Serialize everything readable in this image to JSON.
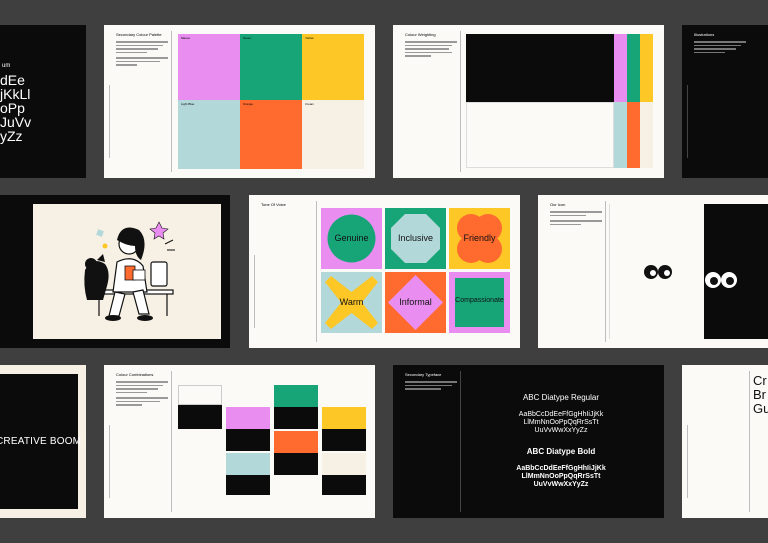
{
  "colors": {
    "bg": "#3f3f3f",
    "magenta": "#e98ef0",
    "green": "#17a578",
    "yellow": "#fdc726",
    "blue": "#b3d8da",
    "orange": "#ff6a2e",
    "cream": "#f7f1e5",
    "black": "#0b0b0b"
  },
  "row1": {
    "type_specimen": {
      "header": "um",
      "lines": [
        "dEe",
        "jKkLl",
        "oPp",
        "JuVv",
        "yZz"
      ]
    },
    "secondary_palette": {
      "title": "Secondary Colour Palette",
      "swatch_names": [
        "Mauve",
        "Green",
        "Yellow",
        "Light Blue",
        "Orange",
        "Cream"
      ]
    },
    "colour_weighting": {
      "title": "Colour Weighting"
    },
    "illustrations": {
      "title": "Illustrations"
    }
  },
  "row2": {
    "tone_of_voice": {
      "title": "Tone Of Voice",
      "words": [
        "Genuine",
        "Inclusive",
        "Friendly",
        "Warm",
        "Informal",
        "Compassionate"
      ]
    },
    "our_icon": {
      "title": "Our Icon"
    }
  },
  "row3": {
    "creative_boom": "CREATIVE BOOM",
    "colour_combinations": {
      "title": "Colour Combinations"
    },
    "secondary_typeface": {
      "title": "Secondary Typeface",
      "regular_name": "ABC Diatype Regular",
      "regular_lines": [
        "AaBbCcDdEeFfGgHhIiJjKk",
        "LlMmNnOoPpQqRrSsTt",
        "UuVvWwXxYyZz"
      ],
      "bold_name": "ABC Diatype Bold",
      "bold_lines": [
        "AaBbCcDdEeFfGgHhIiJjKk",
        "LlMmNnOoPpQqRrSsTt",
        "UuVvWwXxYyZz"
      ]
    },
    "cut_card": {
      "lines": [
        "Cr",
        "Br",
        "Gu"
      ]
    }
  }
}
